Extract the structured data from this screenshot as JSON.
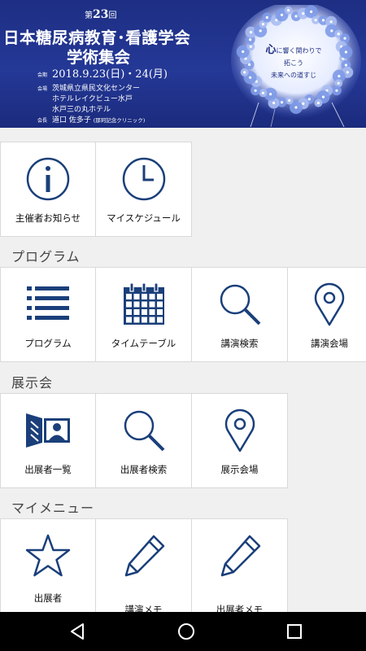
{
  "banner": {
    "edition_prefix": "第",
    "edition_number": "23",
    "edition_suffix": "回",
    "title_line1": "日本糖尿病教育･看護学会",
    "title_line2": "学術集会",
    "date_tag": "会期",
    "date": "2018.9.23(日)・24(月)",
    "venue_tag": "会場",
    "venue1": "茨城県立県民文化センター",
    "venue2": "ホテルレイクビュー水戸",
    "venue3": "水戸三の丸ホテル",
    "chair_tag": "会長",
    "chair_name": "道口 佐多子",
    "chair_affil": "(那珂記念クリニック)",
    "motto_big": "心",
    "motto_line1": "に響く関わりで",
    "motto_line2": "拓こう",
    "motto_line3": "未来への道すじ"
  },
  "top_tiles": [
    {
      "label": "主催者お知らせ",
      "icon": "info-icon"
    },
    {
      "label": "マイスケジュール",
      "icon": "clock-icon"
    }
  ],
  "sections": {
    "program": {
      "title": "プログラム",
      "tiles": [
        {
          "label": "プログラム",
          "icon": "list-icon"
        },
        {
          "label": "タイムテーブル",
          "icon": "calendar-icon"
        },
        {
          "label": "講演検索",
          "icon": "search-icon"
        },
        {
          "label": "講演会場",
          "icon": "map-pin-icon"
        }
      ]
    },
    "exhibition": {
      "title": "展示会",
      "tiles": [
        {
          "label": "出展者一覧",
          "icon": "presentation-icon"
        },
        {
          "label": "出展者検索",
          "icon": "search-icon"
        },
        {
          "label": "展示会場",
          "icon": "map-pin-icon"
        }
      ]
    },
    "mymenu": {
      "title": "マイメニュー",
      "tiles": [
        {
          "label": "出展者",
          "icon": "star-icon"
        },
        {
          "label": "講演メモ",
          "icon": "pencil-icon"
        },
        {
          "label": "出展者メモ",
          "icon": "pencil-icon"
        }
      ]
    }
  },
  "navbar": {
    "back": "back-icon",
    "home": "home-icon",
    "recents": "recents-icon"
  },
  "colors": {
    "icon": "#1a3f7a",
    "banner": "#243896"
  }
}
